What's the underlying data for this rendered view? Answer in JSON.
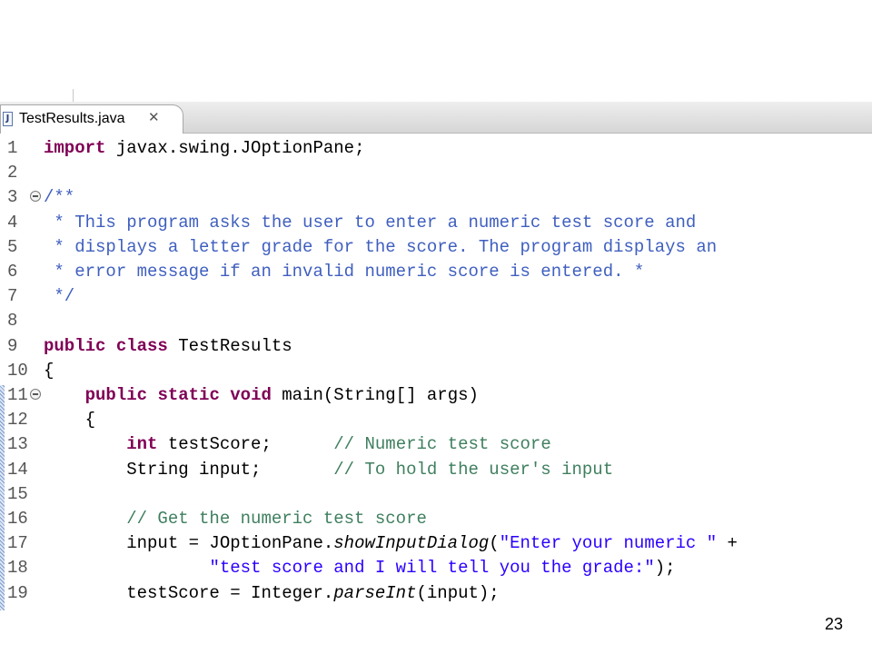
{
  "editor": {
    "tab": {
      "label": "TestResults.java",
      "icon": "java-file-icon",
      "close_icon": "close-icon",
      "close_glyph": "✕",
      "icon_glyph": "J"
    },
    "lines": [
      {
        "n": "1",
        "tokens": [
          {
            "t": "import",
            "c": "kw"
          },
          {
            "t": " javax.swing.JOptionPane;",
            "c": "pl"
          }
        ]
      },
      {
        "n": "2",
        "tokens": []
      },
      {
        "n": "3",
        "fold": true,
        "tokens": [
          {
            "t": "/**",
            "c": "jd"
          }
        ]
      },
      {
        "n": "4",
        "tokens": [
          {
            "t": " * This program asks the user to enter a numeric test score and",
            "c": "jd"
          }
        ]
      },
      {
        "n": "5",
        "tokens": [
          {
            "t": " * displays a letter grade for the score. The program displays an",
            "c": "jd"
          }
        ]
      },
      {
        "n": "6",
        "tokens": [
          {
            "t": " * error message if an invalid numeric score is entered. *",
            "c": "jd"
          }
        ]
      },
      {
        "n": "7",
        "tokens": [
          {
            "t": " */",
            "c": "jd"
          }
        ]
      },
      {
        "n": "8",
        "tokens": []
      },
      {
        "n": "9",
        "tokens": [
          {
            "t": "public",
            "c": "kw"
          },
          {
            "t": " ",
            "c": "pl"
          },
          {
            "t": "class",
            "c": "kw"
          },
          {
            "t": " TestResults",
            "c": "pl"
          }
        ]
      },
      {
        "n": "10",
        "tokens": [
          {
            "t": "{",
            "c": "pl"
          }
        ]
      },
      {
        "n": "11",
        "fold": true,
        "tokens": [
          {
            "t": "    ",
            "c": "pl"
          },
          {
            "t": "public",
            "c": "kw"
          },
          {
            "t": " ",
            "c": "pl"
          },
          {
            "t": "static",
            "c": "kw"
          },
          {
            "t": " ",
            "c": "pl"
          },
          {
            "t": "void",
            "c": "kw"
          },
          {
            "t": " main(String[] args)",
            "c": "pl"
          }
        ]
      },
      {
        "n": "12",
        "tokens": [
          {
            "t": "    {",
            "c": "pl"
          }
        ]
      },
      {
        "n": "13",
        "tokens": [
          {
            "t": "        ",
            "c": "pl"
          },
          {
            "t": "int",
            "c": "kw"
          },
          {
            "t": " testScore;      ",
            "c": "pl"
          },
          {
            "t": "// Numeric test score",
            "c": "cm"
          }
        ]
      },
      {
        "n": "14",
        "tokens": [
          {
            "t": "        String input;       ",
            "c": "pl"
          },
          {
            "t": "// To hold the user's input",
            "c": "cm"
          }
        ]
      },
      {
        "n": "15",
        "tokens": []
      },
      {
        "n": "16",
        "tokens": [
          {
            "t": "        ",
            "c": "pl"
          },
          {
            "t": "// Get the numeric test score",
            "c": "cm"
          }
        ]
      },
      {
        "n": "17",
        "tokens": [
          {
            "t": "        input = JOptionPane.",
            "c": "pl"
          },
          {
            "t": "showInputDialog",
            "c": "it"
          },
          {
            "t": "(",
            "c": "pl"
          },
          {
            "t": "\"Enter your numeric \"",
            "c": "st"
          },
          {
            "t": " +",
            "c": "pl"
          }
        ]
      },
      {
        "n": "18",
        "tokens": [
          {
            "t": "                ",
            "c": "pl"
          },
          {
            "t": "\"test score and I will tell you the grade:\"",
            "c": "st"
          },
          {
            "t": ");",
            "c": "pl"
          }
        ]
      },
      {
        "n": "19",
        "tokens": [
          {
            "t": "        testScore = Integer.",
            "c": "pl"
          },
          {
            "t": "parseInt",
            "c": "it"
          },
          {
            "t": "(input);",
            "c": "pl"
          }
        ]
      }
    ]
  },
  "slide": {
    "page_number": "23"
  },
  "colors": {
    "keyword": "#7f0055",
    "comment": "#3f7f5f",
    "javadoc": "#3f5fbf",
    "string": "#2a00ff"
  }
}
